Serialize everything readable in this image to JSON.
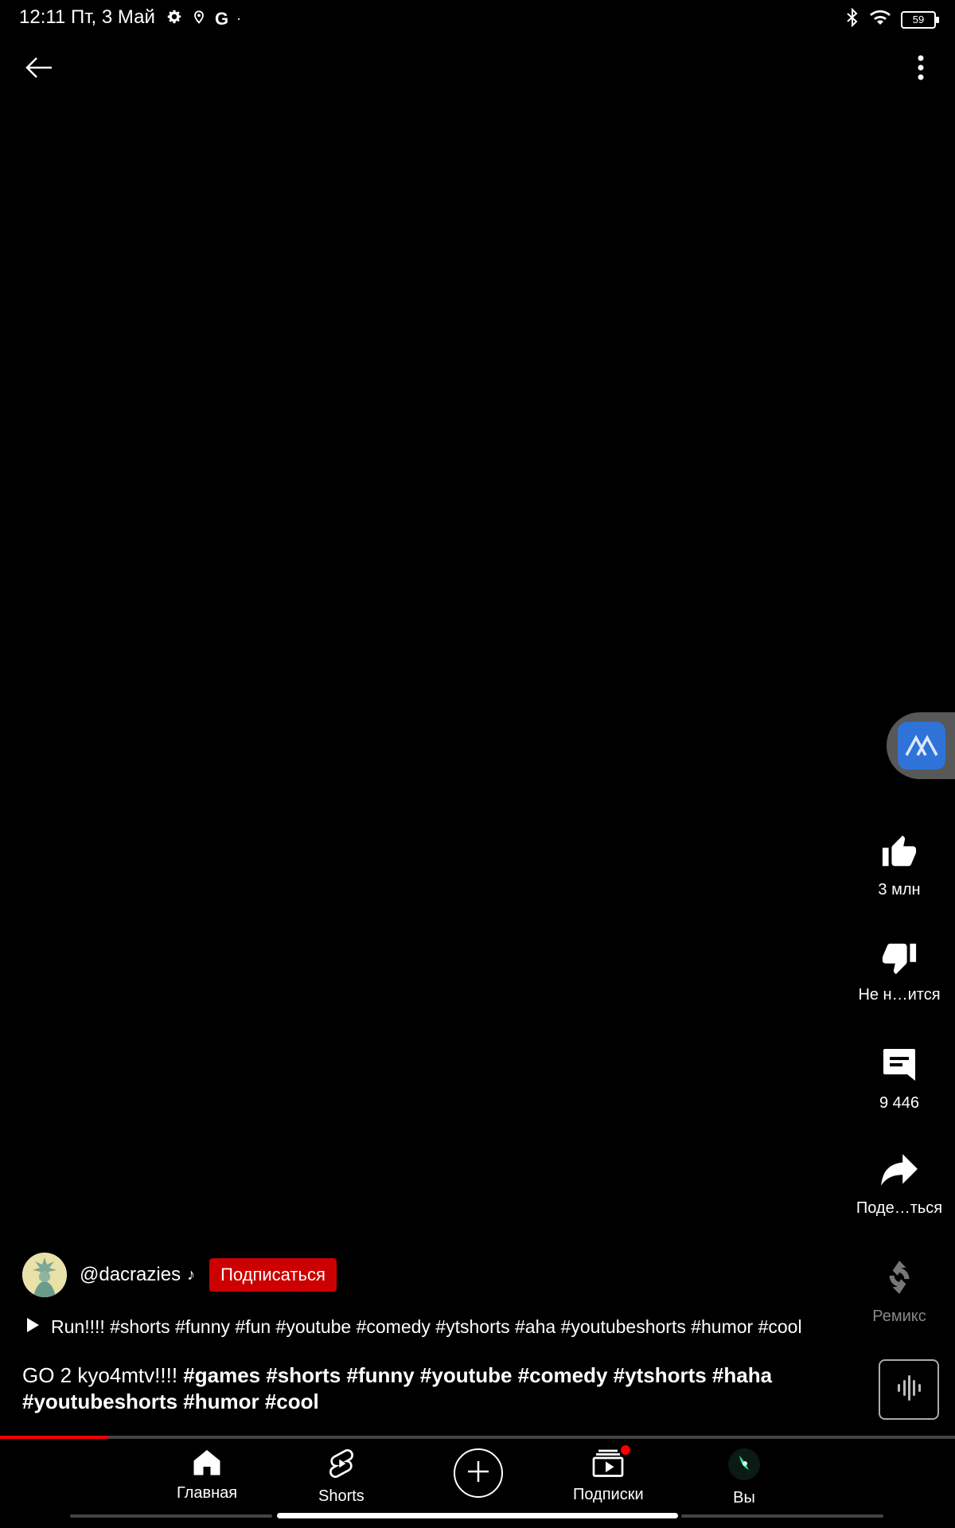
{
  "status_bar": {
    "time_date": "12:11 Пт, 3 Май",
    "left_icons": [
      "gear-icon",
      "location-icon",
      "google-icon",
      "dot-icon"
    ],
    "battery": "59"
  },
  "header": {
    "back_icon": "arrow-left-icon",
    "more_icon": "more-vertical-icon"
  },
  "actions": {
    "like": "3 млн",
    "dislike": "Не н…ится",
    "comments": "9 446",
    "share": "Поде…ться",
    "remix": "Ремикс"
  },
  "channel": {
    "name": "@dacrazies",
    "subscribe": "Подписаться"
  },
  "music": {
    "title": "Run!!!! #shorts #funny #fun #youtube #comedy #ytshorts #aha #youtubeshorts #humor #cool"
  },
  "description": {
    "plain": "GO 2 kyo4mtv!!!! ",
    "tags": "#games #shorts #funny #youtube #comedy #ytshorts #haha #youtubeshorts #humor #cool"
  },
  "progress": {
    "fraction": 0.113
  },
  "nav": {
    "home": "Главная",
    "shorts": "Shorts",
    "subscriptions": "Подписки",
    "you": "Вы"
  },
  "colors": {
    "accent": "#cc0000",
    "progress": "#ff0000",
    "background": "#000000"
  }
}
